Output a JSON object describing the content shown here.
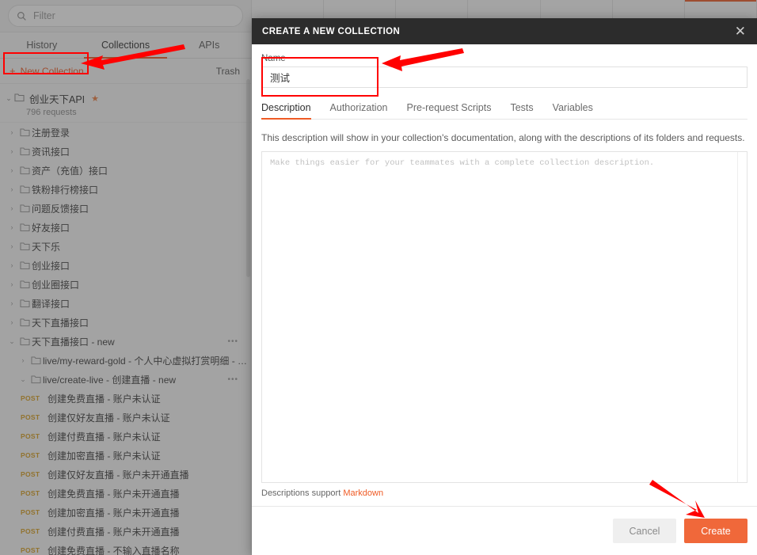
{
  "sidebar": {
    "search": {
      "placeholder": "Filter",
      "icon": "search-icon"
    },
    "tabs": [
      {
        "label": "History",
        "active": false
      },
      {
        "label": "Collections",
        "active": true
      },
      {
        "label": "APIs",
        "active": false
      }
    ],
    "new_collection_label": "New Collection",
    "new_collection_plus": "+",
    "trash_label": "Trash",
    "collection": {
      "name": "创业天下API",
      "requests_count": "796 requests",
      "starred": true,
      "star_glyph": "★",
      "expanded": true
    },
    "folders": [
      {
        "label": "注册登录",
        "level": 1,
        "expanded": false,
        "menu": false
      },
      {
        "label": "资讯接口",
        "level": 1,
        "expanded": false,
        "menu": false
      },
      {
        "label": "资产（充值）接口",
        "level": 1,
        "expanded": false,
        "menu": false
      },
      {
        "label": "铁粉排行榜接口",
        "level": 1,
        "expanded": false,
        "menu": false
      },
      {
        "label": "问题反馈接口",
        "level": 1,
        "expanded": false,
        "menu": false
      },
      {
        "label": "好友接口",
        "level": 1,
        "expanded": false,
        "menu": false
      },
      {
        "label": "天下乐",
        "level": 1,
        "expanded": false,
        "menu": false
      },
      {
        "label": "创业接口",
        "level": 1,
        "expanded": false,
        "menu": false
      },
      {
        "label": "创业圈接口",
        "level": 1,
        "expanded": false,
        "menu": false
      },
      {
        "label": "翻译接口",
        "level": 1,
        "expanded": false,
        "menu": false
      },
      {
        "label": "天下直播接口",
        "level": 1,
        "expanded": false,
        "menu": false
      },
      {
        "label": "天下直播接口 - new",
        "level": 1,
        "expanded": true,
        "menu": true
      },
      {
        "label": "live/my-reward-gold - 个人中心虚拟打赏明细 - new",
        "level": 2,
        "expanded": false,
        "menu": false
      },
      {
        "label": "live/create-live - 创建直播 - new",
        "level": 2,
        "expanded": true,
        "menu": true
      }
    ],
    "requests": [
      {
        "method": "POST",
        "label": "创建免费直播 - 账户未认证"
      },
      {
        "method": "POST",
        "label": "创建仅好友直播 - 账户未认证"
      },
      {
        "method": "POST",
        "label": "创建付费直播 - 账户未认证"
      },
      {
        "method": "POST",
        "label": "创建加密直播 - 账户未认证"
      },
      {
        "method": "POST",
        "label": "创建仅好友直播 - 账户未开通直播"
      },
      {
        "method": "POST",
        "label": "创建免费直播 - 账户未开通直播"
      },
      {
        "method": "POST",
        "label": "创建加密直播 - 账户未开通直播"
      },
      {
        "method": "POST",
        "label": "创建付费直播 - 账户未开通直播"
      },
      {
        "method": "POST",
        "label": "创建免费直播 - 不输入直播名称"
      }
    ]
  },
  "modal": {
    "title": "CREATE A NEW COLLECTION",
    "close_glyph": "✕",
    "name_label": "Name",
    "name_value": "测试",
    "name_placeholder": "",
    "tabs": [
      {
        "label": "Description",
        "active": true
      },
      {
        "label": "Authorization",
        "active": false
      },
      {
        "label": "Pre-request Scripts",
        "active": false
      },
      {
        "label": "Tests",
        "active": false
      },
      {
        "label": "Variables",
        "active": false
      }
    ],
    "description_note": "This description will show in your collection's documentation, along with the descriptions of its folders and requests.",
    "description_placeholder": "Make things easier for your teammates with a complete collection description.",
    "description_value": "",
    "markdown_note_prefix": "Descriptions support ",
    "markdown_link": "Markdown",
    "cancel_label": "Cancel",
    "create_label": "Create"
  },
  "colors": {
    "accent_orange": "#ef5b25",
    "create_button": "#f0683a",
    "method_post": "#d9a020",
    "annotation_red": "#ff0000",
    "modal_header": "#2c2c2c"
  }
}
